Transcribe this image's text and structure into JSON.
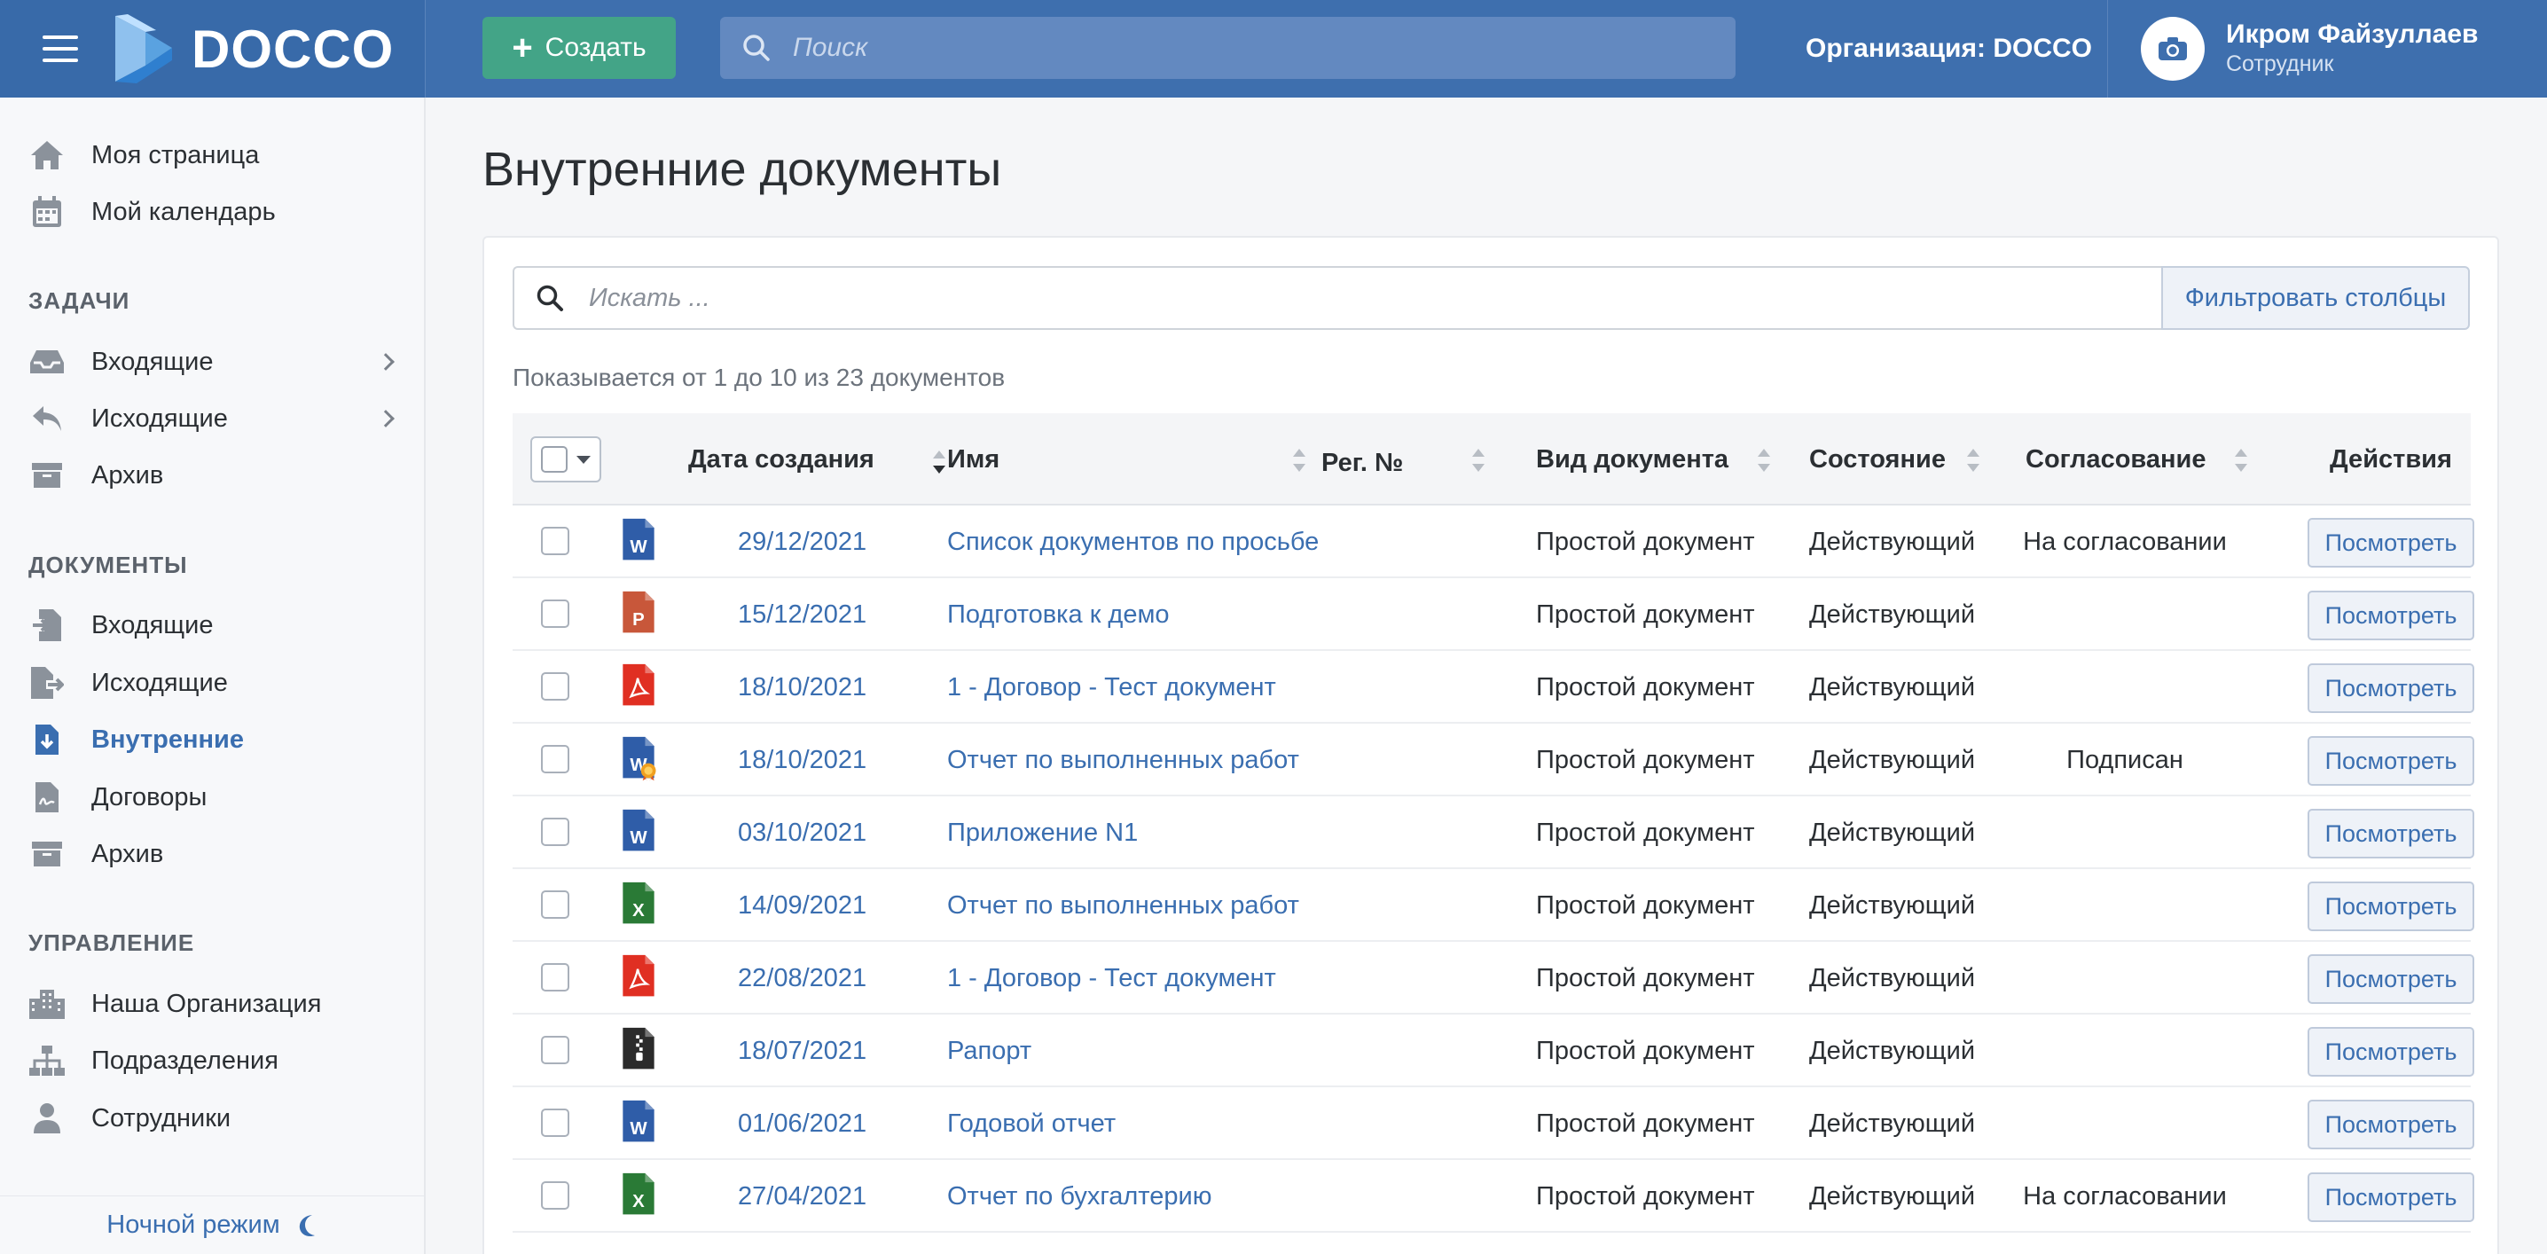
{
  "app": {
    "brand": "DOCCO"
  },
  "header": {
    "create_label": "Создать",
    "search_placeholder": "Поиск",
    "organization": "Организация: DOCCO",
    "user_name": "Икром Файзуллаев",
    "user_role": "Сотрудник"
  },
  "sidebar": {
    "top": [
      {
        "label": "Моя страница",
        "icon": "home-icon"
      },
      {
        "label": "Мой календарь",
        "icon": "calendar-icon"
      }
    ],
    "sections": {
      "tasks": "ЗАДАЧИ",
      "documents": "ДОКУМЕНТЫ",
      "management": "УПРАВЛЕНИЕ"
    },
    "tasks": [
      {
        "label": "Входящие",
        "icon": "inbox-icon",
        "has_submenu": true
      },
      {
        "label": "Исходящие",
        "icon": "reply-icon",
        "has_submenu": true
      },
      {
        "label": "Архив",
        "icon": "archive-icon"
      }
    ],
    "documents": [
      {
        "label": "Входящие",
        "icon": "file-import-icon"
      },
      {
        "label": "Исходящие",
        "icon": "file-export-icon"
      },
      {
        "label": "Внутренние",
        "icon": "file-download-icon",
        "active": true
      },
      {
        "label": "Договоры",
        "icon": "file-signature-icon"
      },
      {
        "label": "Архив",
        "icon": "archive-icon"
      }
    ],
    "management": [
      {
        "label": "Наша Организация",
        "icon": "building-icon"
      },
      {
        "label": "Подразделения",
        "icon": "sitemap-icon"
      },
      {
        "label": "Сотрудники",
        "icon": "user-icon"
      }
    ],
    "night_mode": "Ночной режим"
  },
  "main": {
    "title": "Внутренние документы",
    "search_placeholder": "Искать ...",
    "filter_label": "Фильтровать столбцы",
    "showing": "Показывается от 1 до 10 из 23 документов",
    "columns": {
      "date": "Дата создания",
      "name": "Имя",
      "reg": "Рег. №",
      "kind": "Вид документа",
      "state": "Состояние",
      "approval": "Согласование",
      "actions": "Действия"
    },
    "rows": [
      {
        "type": "word",
        "date": "29/12/2021",
        "name": "Список документов по просьбе",
        "kind": "Простой документ",
        "state": "Действующий",
        "approval": "На согласовании",
        "action": "Посмотреть"
      },
      {
        "type": "powerpoint",
        "date": "15/12/2021",
        "name": "Подготовка к демо",
        "kind": "Простой документ",
        "state": "Действующий",
        "approval": "",
        "action": "Посмотреть"
      },
      {
        "type": "pdf",
        "date": "18/10/2021",
        "name": "1 - Договор - Тест документ",
        "kind": "Простой документ",
        "state": "Действующий",
        "approval": "",
        "action": "Посмотреть"
      },
      {
        "type": "word-signed",
        "date": "18/10/2021",
        "name": "Отчет по выполненных работ",
        "kind": "Простой документ",
        "state": "Действующий",
        "approval": "Подписан",
        "action": "Посмотреть"
      },
      {
        "type": "word",
        "date": "03/10/2021",
        "name": "Приложение N1",
        "kind": "Простой документ",
        "state": "Действующий",
        "approval": "",
        "action": "Посмотреть"
      },
      {
        "type": "excel",
        "date": "14/09/2021",
        "name": "Отчет по выполненных работ",
        "kind": "Простой документ",
        "state": "Действующий",
        "approval": "",
        "action": "Посмотреть"
      },
      {
        "type": "pdf",
        "date": "22/08/2021",
        "name": "1 - Договор - Тест документ",
        "kind": "Простой документ",
        "state": "Действующий",
        "approval": "",
        "action": "Посмотреть"
      },
      {
        "type": "archive",
        "date": "18/07/2021",
        "name": "Рапорт",
        "kind": "Простой документ",
        "state": "Действующий",
        "approval": "",
        "action": "Посмотреть"
      },
      {
        "type": "word",
        "date": "01/06/2021",
        "name": "Годовой отчет",
        "kind": "Простой документ",
        "state": "Действующий",
        "approval": "",
        "action": "Посмотреть"
      },
      {
        "type": "excel",
        "date": "27/04/2021",
        "name": "Отчет по бухгалтерию",
        "kind": "Простой документ",
        "state": "Действующий",
        "approval": "На согласовании",
        "action": "Посмотреть"
      }
    ]
  },
  "colors": {
    "header": "#3e6fae",
    "create_button": "#43a487",
    "link": "#3a6eb0",
    "word": "#2f5da8",
    "powerpoint": "#c8573a",
    "pdf": "#e02f22",
    "excel": "#2a7a36",
    "archive": "#2b2b2b"
  }
}
